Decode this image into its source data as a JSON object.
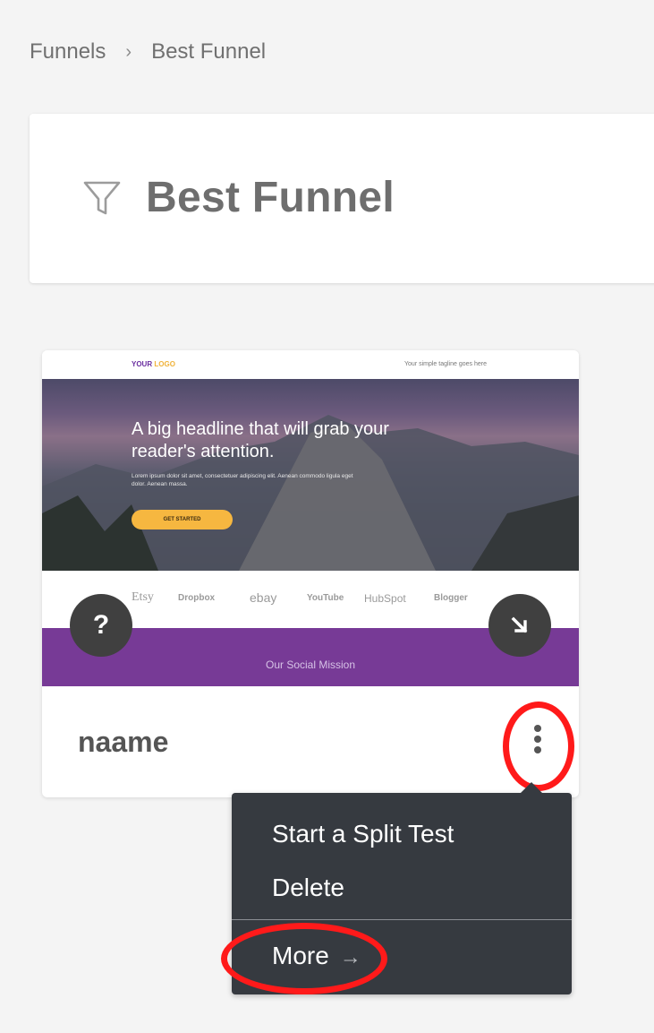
{
  "breadcrumb": {
    "items": [
      "Funnels",
      "Best Funnel"
    ],
    "separator": "›"
  },
  "header": {
    "title": "Best Funnel",
    "icon": "funnel-icon"
  },
  "page_card": {
    "name": "naame",
    "thumbnail": {
      "logo": "YOUR",
      "logo_accent": "LOGO",
      "tagline": "Your simple tagline goes here",
      "headline": "A big headline that will grab your reader's attention.",
      "body": "Lorem ipsum dolor sit amet, consectetuer adipiscing elit. Aenean commodo ligula eget dolor. Aenean massa.",
      "cta": "GET STARTED",
      "brands": [
        "Etsy",
        "Dropbox",
        "ebay",
        "YouTube",
        "HubSpot",
        "Blogger"
      ],
      "mission": "Our Social Mission"
    },
    "help_button_label": "?",
    "open_icon": "arrow-down-right-icon",
    "menu_icon": "kebab-menu-icon"
  },
  "context_menu": {
    "items": [
      "Start a Split Test",
      "Delete"
    ],
    "more_label": "More",
    "more_icon": "arrow-right-icon"
  },
  "colors": {
    "background": "#f4f4f4",
    "menu_bg": "#363a40",
    "mission_purple": "#773a96",
    "cta_yellow": "#f6b740",
    "highlight_red": "#ff1a1a"
  }
}
